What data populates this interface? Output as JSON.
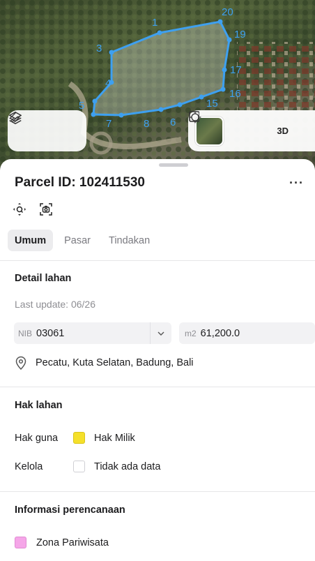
{
  "map": {
    "parcel_color": "#3ea0f0",
    "vertex_labels": [
      "1",
      "20",
      "19",
      "3",
      "17",
      "4",
      "16",
      "5",
      "15",
      "7",
      "8",
      "6"
    ],
    "layers_icon": "layers-icon",
    "draw_icon": "draw-icon",
    "locate_icon": "crosshair-icon",
    "toggle_3d_label": "3D"
  },
  "sheet": {
    "title": "Parcel ID: 102411530",
    "more_label": "···",
    "tabs": [
      {
        "label": "Umum",
        "active": true
      },
      {
        "label": "Pasar",
        "active": false
      },
      {
        "label": "Tindakan",
        "active": false
      }
    ],
    "detail": {
      "heading": "Detail lahan",
      "last_update": "Last update: 06/26",
      "nib_prefix": "NIB",
      "nib_value": "03061",
      "area_prefix": "m2",
      "area_value": "61,200.0",
      "location": "Pecatu, Kuta Selatan, Badung, Bali"
    },
    "hak": {
      "heading": "Hak lahan",
      "rows": [
        {
          "label": "Hak guna",
          "value": "Hak Milik",
          "color": "#f5e02a"
        },
        {
          "label": "Kelola",
          "value": "Tidak ada data",
          "color": "#ffffff"
        }
      ]
    },
    "planning": {
      "heading": "Informasi perencanaan",
      "zone": "Zona Pariwisata",
      "zone_color": "#f5a6e8"
    }
  }
}
